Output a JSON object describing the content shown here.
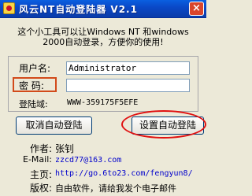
{
  "window": {
    "title": "风云NT自动登陆器  V2.1",
    "close_glyph": "×"
  },
  "intro": {
    "line1": "这个小工具可以让Windows NT 和windows",
    "line2": "2000自动登录，方便你的使用!"
  },
  "form": {
    "username_label": "用户名:",
    "username_value": "Administrator",
    "password_label": "密  码:",
    "password_value": "",
    "domain_label": "登陆域:",
    "domain_value": "WWW-359175F5EFE"
  },
  "buttons": {
    "cancel_label": "取消自动登陆",
    "set_label": "设置自动登陆"
  },
  "info": {
    "author_label": "作者:",
    "author_value": "张钊",
    "email_label": "E-Mail:",
    "email_value": "zzcd77@163.com",
    "homepage_label": "主页:",
    "homepage_value": "http://go.6to23.com/fengyun8/",
    "copyright_label": "版权:",
    "copyright_value": "自由软件，请给我发个电子邮件"
  },
  "colors": {
    "titlebar": "#0a49c8",
    "annotation_circle": "#e01010",
    "password_highlight": "#d24a1a",
    "link": "#0000cc"
  }
}
